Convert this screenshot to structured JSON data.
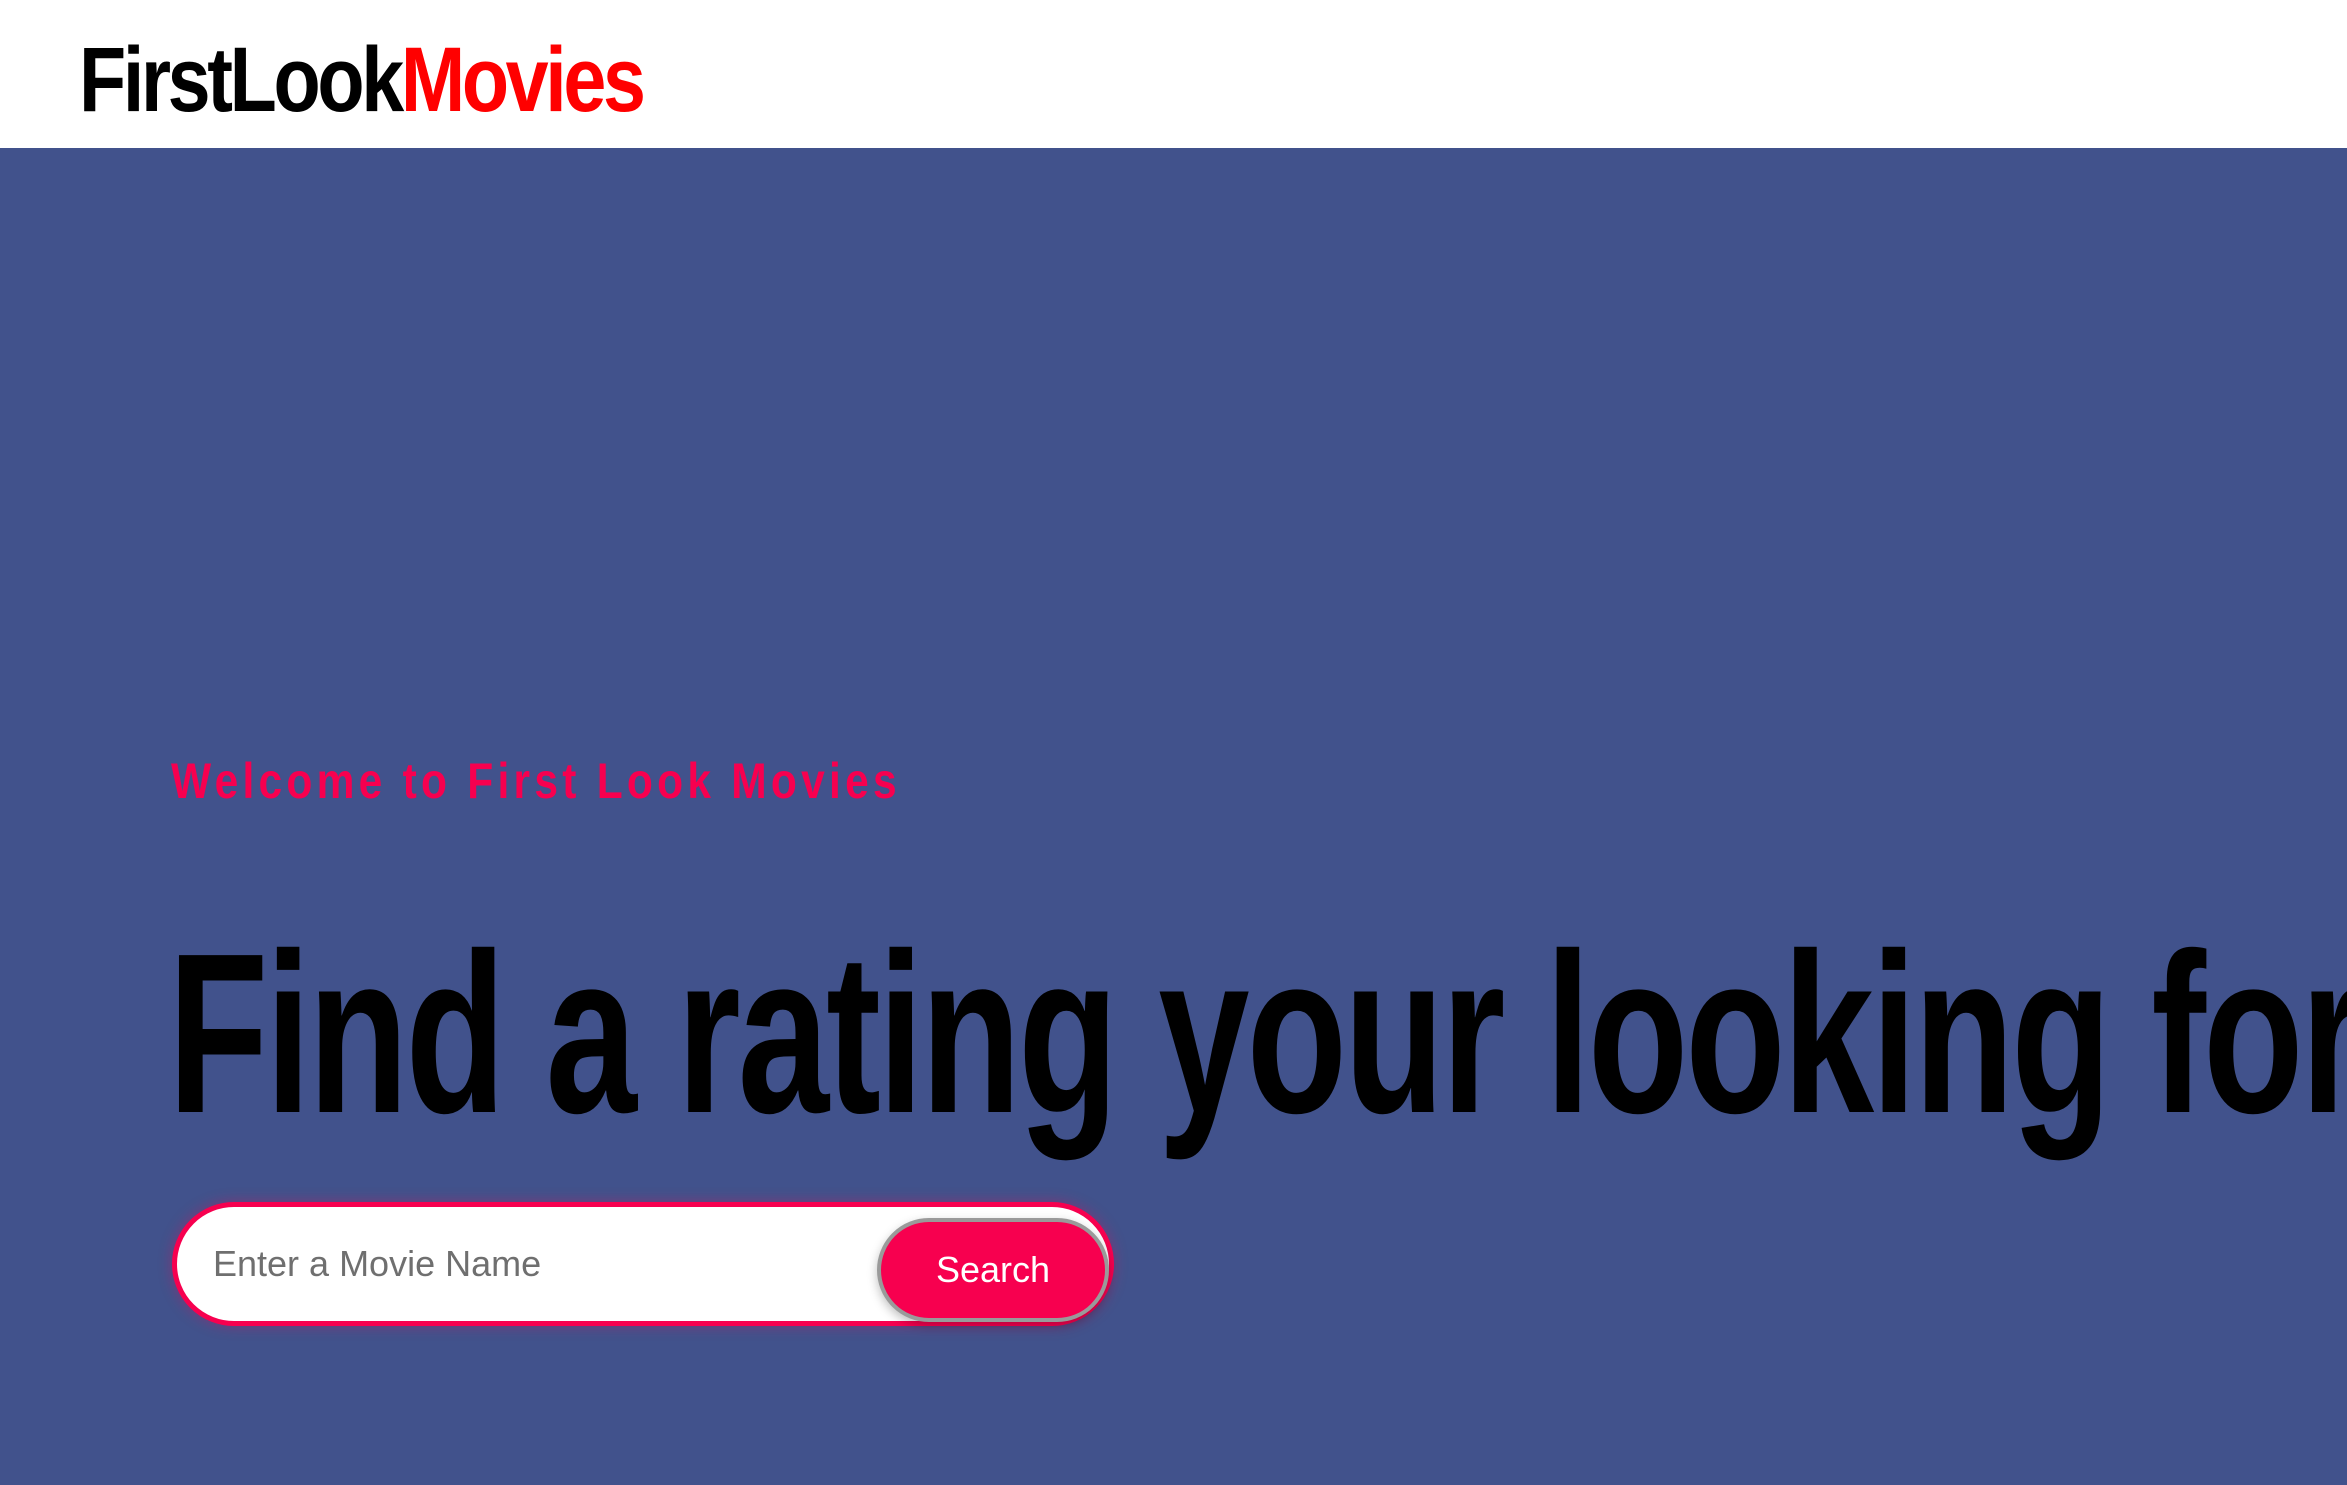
{
  "header": {
    "brand_part1": "FirstLook",
    "brand_part2": "Movies"
  },
  "hero": {
    "welcome": "Welcome to First Look Movies",
    "headline": "Find a rating your looking for"
  },
  "search": {
    "placeholder": "Enter a Movie Name",
    "value": "",
    "button_label": "Search"
  },
  "colors": {
    "header_bg": "#ffffff",
    "hero_bg": "#41528c",
    "accent": "#f7004f",
    "brand_red": "#ff0000"
  }
}
